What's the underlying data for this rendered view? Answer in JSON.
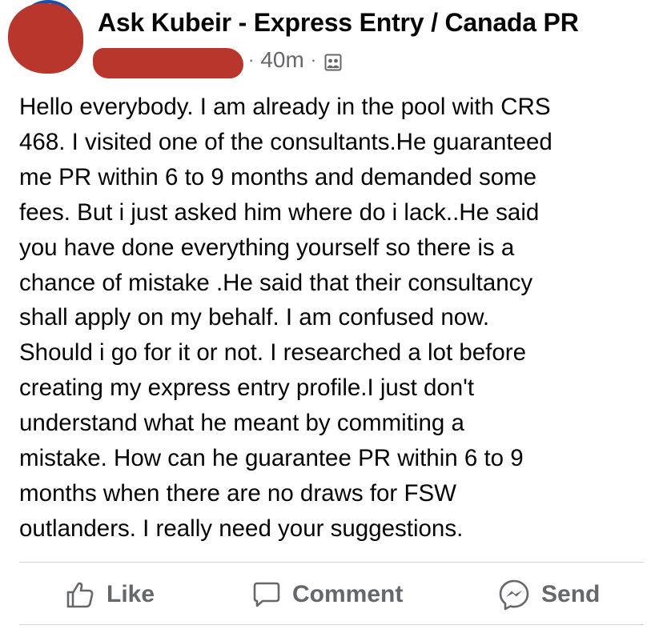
{
  "post": {
    "group_name": "Ask Kubeir - Express Entry / Canada PR",
    "time": "40m",
    "separator": "·",
    "privacy_icon": "group-members-icon",
    "body": "Hello everybody. I am already in the pool with CRS\n468. I visited one of the consultants.He guaranteed\nme PR within 6 to 9 months and demanded some\nfees. But i just asked him where do i lack..He said\nyou have done everything yourself so there is a\nchance of mistake .He said that their consultancy\nshall apply on my behalf. I am confused now.\nShould i go for it or not. I researched a lot before\ncreating my express entry profile.I just don't\nunderstand what he meant by commiting a\nmistake. How can he guarantee PR within 6 to 9\nmonths when there are no draws for FSW\noutlanders. I really need your suggestions."
  },
  "actions": {
    "like_label": "Like",
    "comment_label": "Comment",
    "send_label": "Send"
  },
  "colors": {
    "secondary_text": "#65676b",
    "redaction": "#b8362b"
  }
}
